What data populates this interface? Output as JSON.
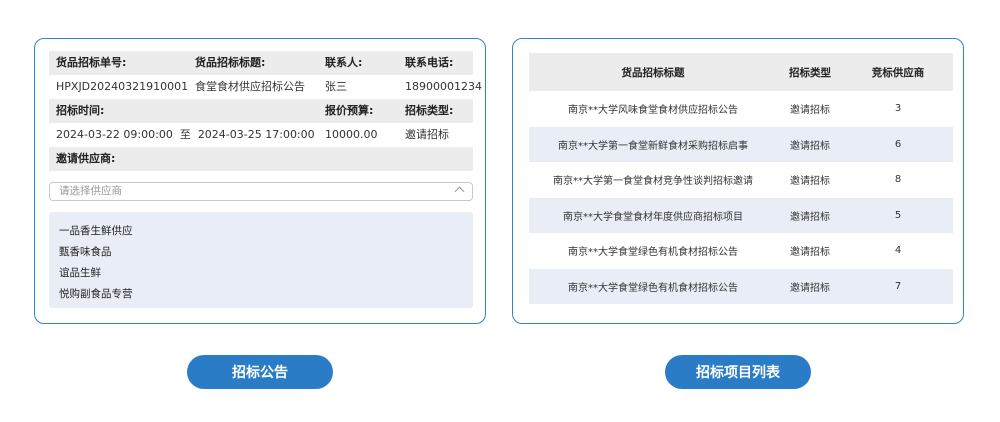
{
  "bid_form": {
    "labels": {
      "order_no": "货品招标单号:",
      "title": "货品招标标题:",
      "contact": "联系人:",
      "phone": "联系电话:",
      "time": "招标时间:",
      "budget": "报价预算:",
      "type": "招标类型:",
      "suppliers": "邀请供应商:"
    },
    "values": {
      "order_no": "HPXJD20240321910001",
      "title": "食堂食材供应招标公告",
      "contact": "张三",
      "phone": "18900001234",
      "time": "2024-03-22 09:00:00  至  2024-03-25 17:00:00",
      "budget": "10000.00",
      "type": "邀请招标"
    },
    "supplier_select": {
      "placeholder": "请选择供应商",
      "options": [
        "一品香生鲜供应",
        "甄香味食品",
        "谊品生鲜",
        "悦购副食品专营"
      ]
    }
  },
  "project_table": {
    "headers": [
      "货品招标标题",
      "招标类型",
      "竞标供应商"
    ],
    "rows": [
      [
        "南京**大学风味食堂食材供应招标公告",
        "邀请招标",
        "3"
      ],
      [
        "南京**大学第一食堂新鲜食材采购招标启事",
        "邀请招标",
        "6"
      ],
      [
        "南京**大学第一食堂食材竞争性谈判招标邀请",
        "邀请招标",
        "8"
      ],
      [
        "南京**大学食堂食材年度供应商招标项目",
        "邀请招标",
        "5"
      ],
      [
        "南京**大学食堂绿色有机食材招标公告",
        "邀请招标",
        "4"
      ],
      [
        "南京**大学食堂绿色有机食材招标公告",
        "邀请招标",
        "7"
      ]
    ]
  },
  "buttons": {
    "notice": "招标公告",
    "project_list": "招标项目列表"
  },
  "colors": {
    "accent": "#2a7cc7",
    "border": "#2e86c9",
    "header_bg": "#ececec",
    "alt_row_bg": "#e9eef6"
  }
}
